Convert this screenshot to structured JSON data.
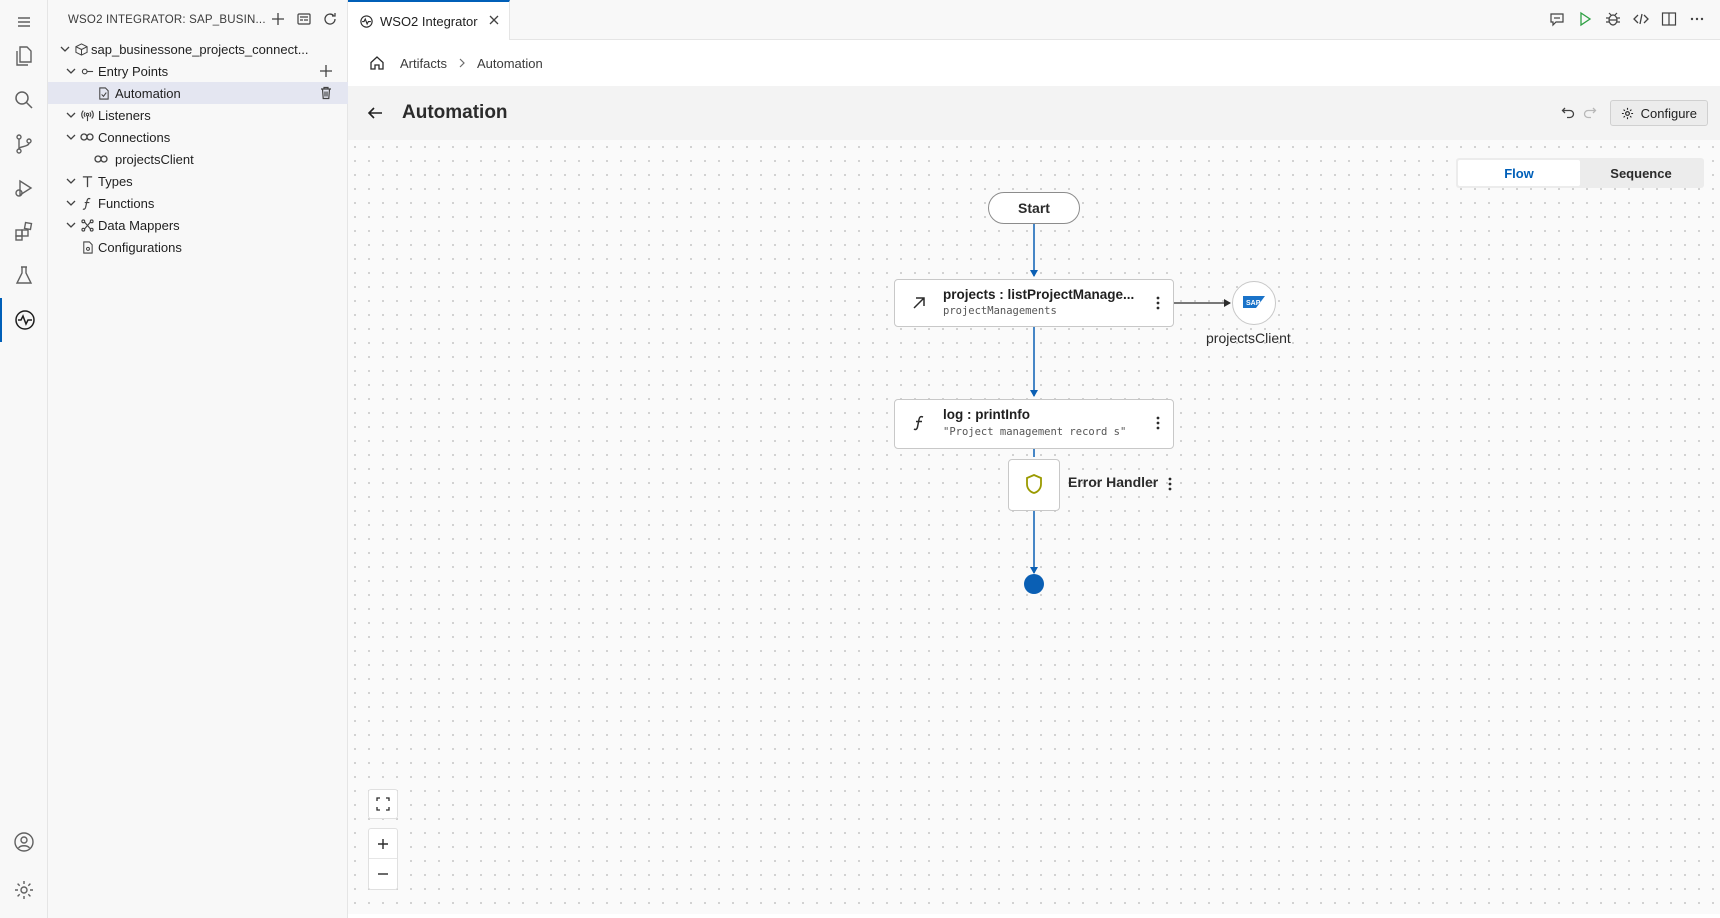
{
  "sidebar": {
    "title": "WSO2 INTEGRATOR: SAP_BUSIN...",
    "project": "sap_businessone_projects_connect...",
    "tree": [
      {
        "label": "Entry Points"
      },
      {
        "label": "Automation"
      },
      {
        "label": "Listeners"
      },
      {
        "label": "Connections"
      },
      {
        "label": "projectsClient"
      },
      {
        "label": "Types"
      },
      {
        "label": "Functions"
      },
      {
        "label": "Data Mappers"
      },
      {
        "label": "Configurations"
      }
    ]
  },
  "tab": {
    "label": "WSO2 Integrator"
  },
  "breadcrumb": {
    "root": "Artifacts",
    "current": "Automation"
  },
  "header": {
    "title": "Automation",
    "configure_label": "Configure"
  },
  "view_toggle": {
    "flow": "Flow",
    "sequence": "Sequence",
    "selected": "Flow"
  },
  "diagram": {
    "start_label": "Start",
    "node1": {
      "title": "projects : listProjectManage...",
      "subtitle": "projectManagements"
    },
    "connection": {
      "label": "projectsClient",
      "icon": "SAP"
    },
    "node2": {
      "title": "log : printInfo",
      "subtitle": "\"Project management record s\""
    },
    "error_handler_label": "Error Handler"
  },
  "colors": {
    "accent": "#005fb8",
    "flow_line": "#0a5fb4",
    "shield": "#9a9a00"
  },
  "zoom_controls": [
    "fit-icon",
    "zoom-in-icon",
    "zoom-out-icon"
  ]
}
